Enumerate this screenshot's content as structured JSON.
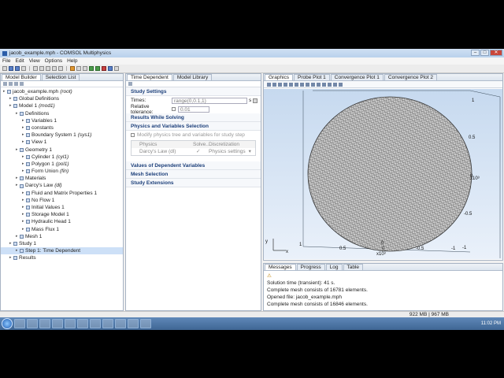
{
  "window": {
    "title": "jacob_example.mph - COMSOL Multiphysics"
  },
  "menu": [
    "File",
    "Edit",
    "View",
    "Options",
    "Help"
  ],
  "left_tabs": [
    "Model Builder",
    "Selection List"
  ],
  "tree": [
    {
      "label": "jacob_example.mph",
      "suffix": "(root)",
      "level": 0
    },
    {
      "label": "Global Definitions",
      "suffix": "",
      "level": 1
    },
    {
      "label": "Model 1",
      "suffix": "(mod1)",
      "level": 1
    },
    {
      "label": "Definitions",
      "suffix": "",
      "level": 2
    },
    {
      "label": "Variables 1",
      "suffix": "",
      "level": 3
    },
    {
      "label": "constants",
      "suffix": "",
      "level": 3
    },
    {
      "label": "Boundary System 1",
      "suffix": "(sys1)",
      "level": 3
    },
    {
      "label": "View 1",
      "suffix": "",
      "level": 3
    },
    {
      "label": "Geometry 1",
      "suffix": "",
      "level": 2
    },
    {
      "label": "Cylinder 1",
      "suffix": "(cyl1)",
      "level": 3
    },
    {
      "label": "Polygon 1",
      "suffix": "(pol1)",
      "level": 3
    },
    {
      "label": "Form Union",
      "suffix": "(fin)",
      "level": 3
    },
    {
      "label": "Materials",
      "suffix": "",
      "level": 2
    },
    {
      "label": "Darcy's Law",
      "suffix": "(dl)",
      "level": 2
    },
    {
      "label": "Fluid and Matrix Properties 1",
      "suffix": "",
      "level": 3
    },
    {
      "label": "No Flow 1",
      "suffix": "",
      "level": 3
    },
    {
      "label": "Initial Values 1",
      "suffix": "",
      "level": 3
    },
    {
      "label": "Storage Model 1",
      "suffix": "",
      "level": 3
    },
    {
      "label": "Hydraulic Head 1",
      "suffix": "",
      "level": 3
    },
    {
      "label": "Mass Flux 1",
      "suffix": "",
      "level": 3
    },
    {
      "label": "Mesh 1",
      "suffix": "",
      "level": 2
    },
    {
      "label": "Study 1",
      "suffix": "",
      "level": 1
    },
    {
      "label": "Step 1: Time Dependent",
      "suffix": "",
      "level": 2,
      "selected": true
    },
    {
      "label": "Results",
      "suffix": "",
      "level": 1
    }
  ],
  "middle_tabs": [
    "Time Dependent",
    "Model Library"
  ],
  "study": {
    "settings_header": "Study Settings",
    "times_label": "Times:",
    "times_value": "range(0,0.1,1)",
    "times_unit": "s",
    "tol_label": "Relative tolerance:",
    "tol_value": "0.01",
    "results_header": "Results While Solving",
    "physics_header": "Physics and Variables Selection",
    "modify_label": "Modify physics tree and variables for study step",
    "table_headers": [
      "Physics",
      "Solve...",
      "Discretization"
    ],
    "table_row": [
      "Darcy's Law (dl)",
      "✓",
      "Physics settings"
    ],
    "dependent_header": "Values of Dependent Variables",
    "mesh_header": "Mesh Selection",
    "ext_header": "Study Extensions"
  },
  "graphics_tabs": [
    "Graphics",
    "Probe Plot 1",
    "Convergence Plot 1",
    "Convergence Plot 2"
  ],
  "axis_labels": {
    "right": [
      "1",
      "0.5",
      "0",
      "-0.5",
      "-1"
    ],
    "bottom": [
      "0.5",
      "0",
      "-0.5",
      "-1"
    ],
    "left_one": "1",
    "z_exp": "x10³",
    "x_exp": "x10³",
    "origin_0": "0",
    "axis_x": "x",
    "axis_y": "y"
  },
  "bottom_tabs": [
    "Messages",
    "Progress",
    "Log",
    "Table"
  ],
  "messages": [
    "Solution time (transient): 41 s.",
    "Complete mesh consists of 16781 elements.",
    "Opened file: jacob_example.mph",
    "Complete mesh consists of 16846 elements."
  ],
  "status": {
    "memory": "922 MB | 967 MB"
  },
  "taskbar": {
    "time": "11:02 PM"
  }
}
